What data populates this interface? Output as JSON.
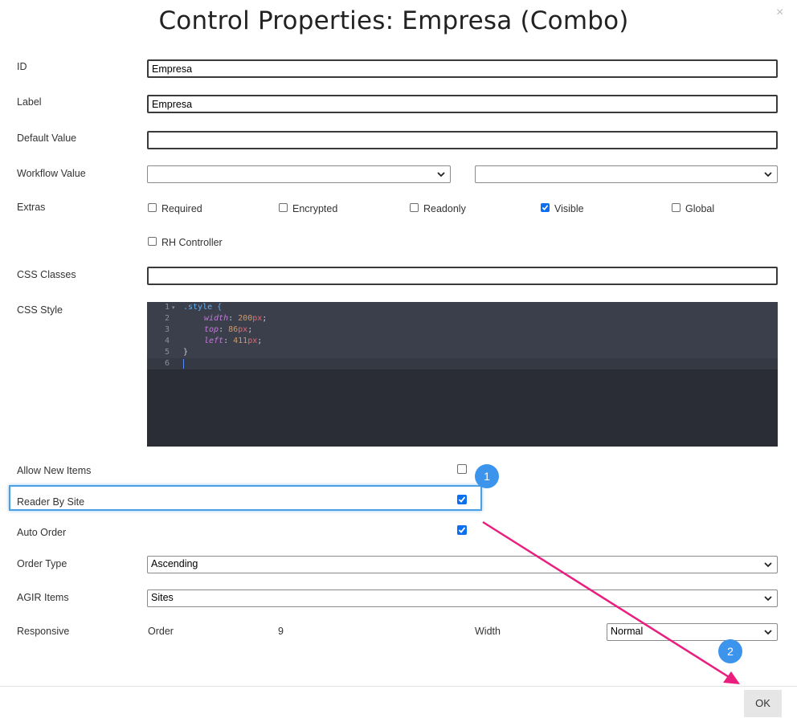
{
  "dialog": {
    "title": "Control Properties: Empresa (Combo)",
    "close_glyph": "×"
  },
  "fields": {
    "id_label": "ID",
    "id_value": "Empresa",
    "label_label": "Label",
    "label_value": "Empresa",
    "default_label": "Default Value",
    "default_value": "",
    "workflow_label": "Workflow Value",
    "workflow_value_1": "",
    "workflow_value_2": "",
    "extras_label": "Extras",
    "extras": [
      {
        "label": "Required",
        "checked": false
      },
      {
        "label": "Encrypted",
        "checked": false
      },
      {
        "label": "Readonly",
        "checked": false
      },
      {
        "label": "Visible",
        "checked": true
      },
      {
        "label": "Global",
        "checked": false
      },
      {
        "label": "RH Controller",
        "checked": false
      }
    ],
    "css_classes_label": "CSS Classes",
    "css_classes_value": "",
    "css_style_label": "CSS Style",
    "allow_new_items_label": "Allow New Items",
    "allow_new_items_checked": false,
    "reader_by_site_label": "Reader By Site",
    "reader_by_site_checked": true,
    "auto_order_label": "Auto Order",
    "auto_order_checked": true,
    "order_type_label": "Order Type",
    "order_type_value": "Ascending",
    "agir_items_label": "AGIR Items",
    "agir_items_value": "Sites",
    "responsive_label": "Responsive",
    "order_label": "Order",
    "order_value": "9",
    "width_label": "Width",
    "width_value": "Normal"
  },
  "editor": {
    "line_numbers": [
      "1",
      "2",
      "3",
      "4",
      "5",
      "6"
    ],
    "line1": ".style {",
    "prop_width": "width",
    "val_width": "200",
    "prop_top": "top",
    "val_top": "86",
    "prop_left": "left",
    "val_left": "411",
    "unit": "px",
    "close_brace": "}"
  },
  "annotations": {
    "badge_1": "1",
    "badge_2": "2",
    "arrow_color": "#e91e7f",
    "highlight_color": "#4aa0e6",
    "badge_color": "#3d94ec"
  },
  "footer": {
    "ok_label": "OK"
  }
}
